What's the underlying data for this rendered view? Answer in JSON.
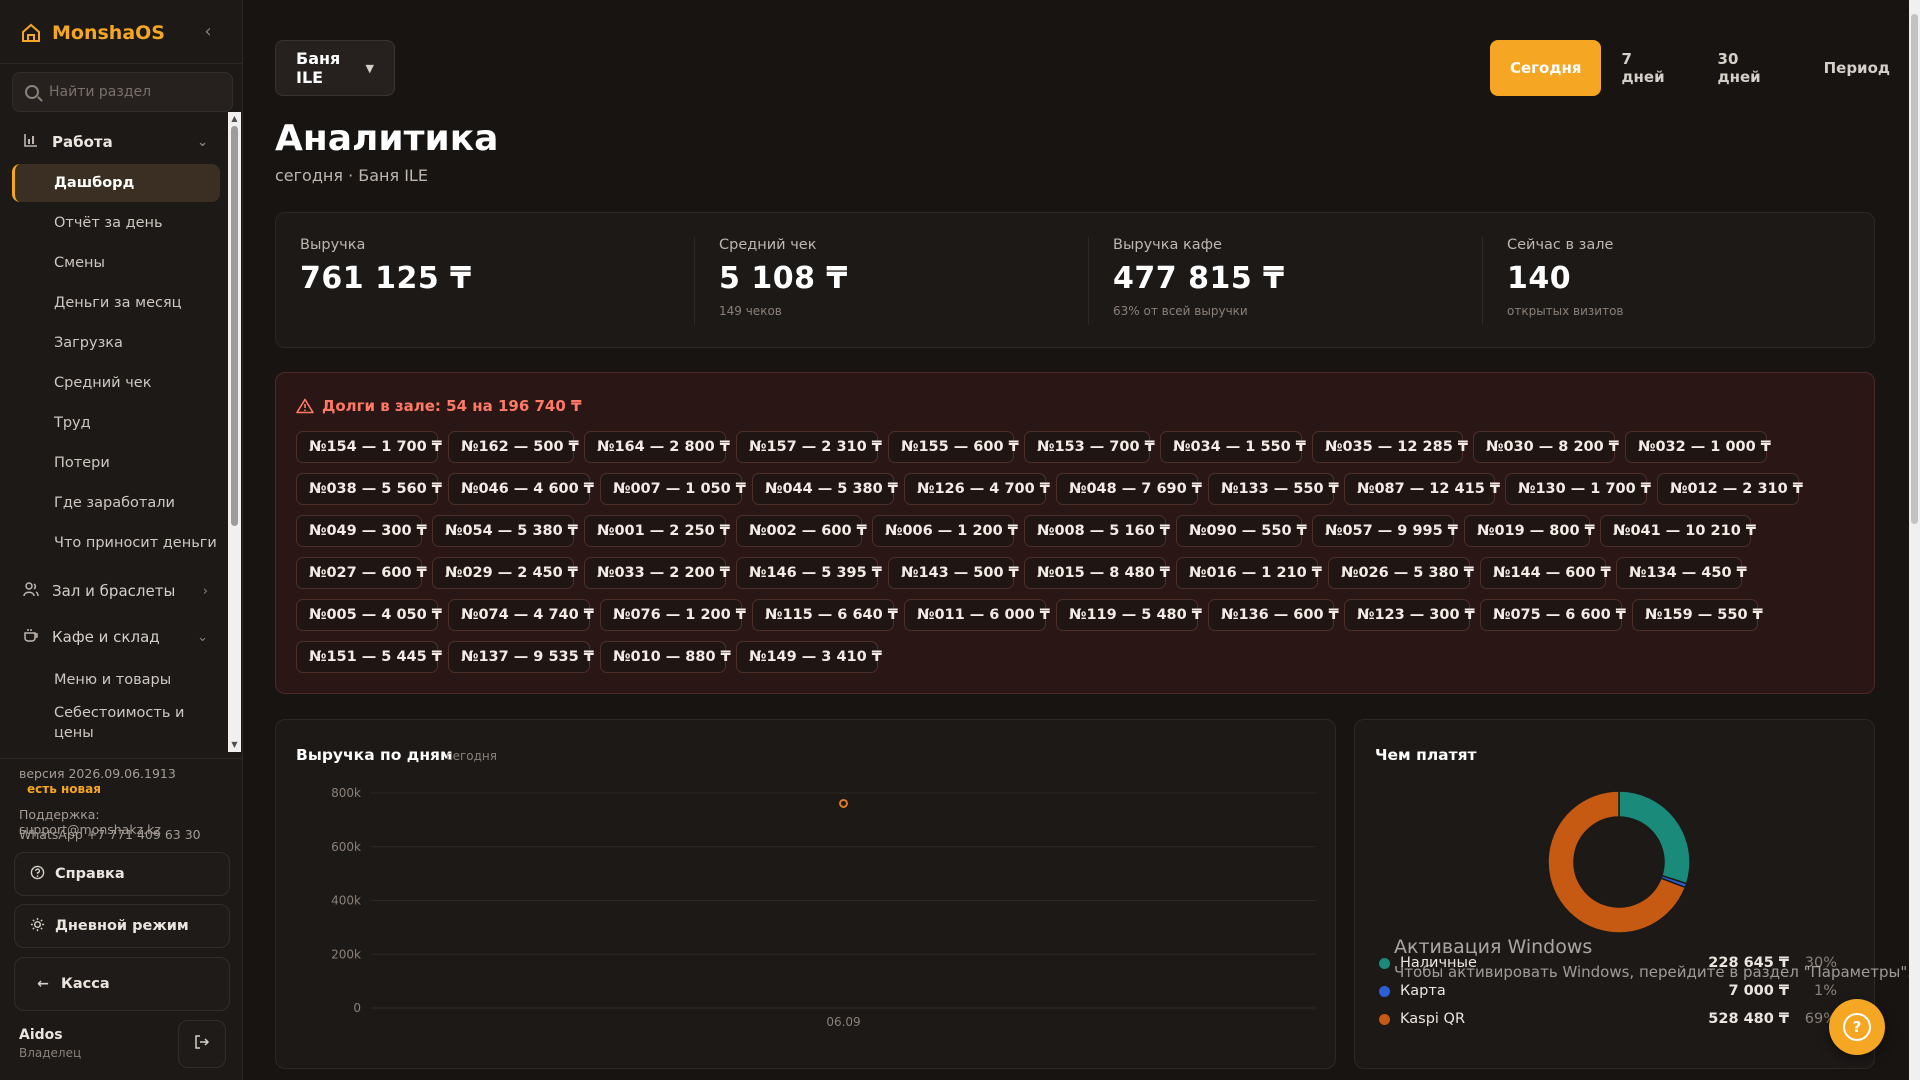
{
  "app": {
    "name": "MonshaOS"
  },
  "sidebar": {
    "search_placeholder": "Найти раздел",
    "groups": {
      "work": "Работа",
      "hall": "Зал и браслеты",
      "cafe": "Кафе и склад"
    },
    "work_items": [
      "Дашборд",
      "Отчёт за день",
      "Смены",
      "Деньги за месяц",
      "Загрузка",
      "Средний чек",
      "Труд",
      "Потери",
      "Где заработали",
      "Что приносит деньги"
    ],
    "cafe_items": [
      "Меню и товары",
      "Себестоимость и цены"
    ],
    "version": "версия 2026.09.06.1913",
    "new_badge": "есть новая",
    "support": "Поддержка: support@monshakz.kz",
    "whatsapp": "WhatsApp +7 771 409 63 30",
    "help_label": "Справка",
    "theme_label": "Дневной режим",
    "kassa_label": "Касса",
    "user": {
      "name": "Aidos",
      "role": "Владелец"
    }
  },
  "header": {
    "venue": "Баня ILE",
    "title": "Аналитика",
    "subtitle": "сегодня · Баня ILE",
    "periods": [
      "Сегодня",
      "7 дней",
      "30 дней",
      "Период"
    ],
    "active_period": "Сегодня"
  },
  "kpis": [
    {
      "label": "Выручка",
      "value": "761 125 ₸",
      "sub": ""
    },
    {
      "label": "Средний чек",
      "value": "5 108 ₸",
      "sub": "149 чеков"
    },
    {
      "label": "Выручка кафе",
      "value": "477 815 ₸",
      "sub": "63% от всей выручки"
    },
    {
      "label": "Сейчас в зале",
      "value": "140",
      "sub": "открытых визитов"
    }
  ],
  "debts": {
    "title": "Долги в зале: 54 на 196 740 ₸",
    "rows": [
      [
        "№154 — 1 700 ₸",
        "№162 — 500 ₸",
        "№164 — 2 800 ₸",
        "№157 — 2 310 ₸",
        "№155 — 600 ₸",
        "№153 — 700 ₸",
        "№034 — 1 550 ₸",
        "№035 — 12 285 ₸",
        "№030 — 8 200 ₸",
        "№032 — 1 000 ₸"
      ],
      [
        "№038 — 5 560 ₸",
        "№046 — 4 600 ₸",
        "№007 — 1 050 ₸",
        "№044 — 5 380 ₸",
        "№126 — 4 700 ₸",
        "№048 — 7 690 ₸",
        "№133 — 550 ₸",
        "№087 — 12 415 ₸",
        "№130 — 1 700 ₸",
        "№012 — 2 310 ₸"
      ],
      [
        "№049 — 300 ₸",
        "№054 — 5 380 ₸",
        "№001 — 2 250 ₸",
        "№002 — 600 ₸",
        "№006 — 1 200 ₸",
        "№008 — 5 160 ₸",
        "№090 — 550 ₸",
        "№057 — 9 995 ₸",
        "№019 — 800 ₸",
        "№041 — 10 210 ₸"
      ],
      [
        "№027 — 600 ₸",
        "№029 — 2 450 ₸",
        "№033 — 2 200 ₸",
        "№146 — 5 395 ₸",
        "№143 — 500 ₸",
        "№015 — 8 480 ₸",
        "№016 — 1 210 ₸",
        "№026 — 5 380 ₸",
        "№144 — 600 ₸",
        "№134 — 450 ₸"
      ],
      [
        "№005 — 4 050 ₸",
        "№074 — 4 740 ₸",
        "№076 — 1 200 ₸",
        "№115 — 6 640 ₸",
        "№011 — 6 000 ₸",
        "№119 — 5 480 ₸",
        "№136 — 600 ₸",
        "№123 — 300 ₸",
        "№075 — 6 600 ₸",
        "№159 — 550 ₸"
      ],
      [
        "№151 — 5 445 ₸",
        "№137 — 9 535 ₸",
        "№010 — 880 ₸",
        "№149 — 3 410 ₸"
      ]
    ]
  },
  "revenue_chart": {
    "title": "Выручка по дням",
    "subtitle": "сегодня"
  },
  "chart_data": {
    "type": "line",
    "x": [
      "06.09"
    ],
    "series": [
      {
        "values": [
          761125
        ]
      }
    ],
    "ylim": [
      0,
      800000
    ],
    "yticks": [
      "0",
      "200k",
      "400k",
      "600k",
      "800k"
    ],
    "grid": true,
    "colors": [
      "#e07a1f"
    ]
  },
  "payments": {
    "title": "Чем платят",
    "items": [
      {
        "label": "Наличные",
        "amount": "228 645 ₸",
        "pct": "30%",
        "value": 228645,
        "color": "#1a8a7a"
      },
      {
        "label": "Карта",
        "amount": "7 000 ₸",
        "pct": "1%",
        "value": 7000,
        "color": "#2c5fd6"
      },
      {
        "label": "Kaspi QR",
        "amount": "528 480 ₸",
        "pct": "69%",
        "value": 528480,
        "color": "#c65a12"
      }
    ]
  },
  "watermark": {
    "title": "Активация Windows",
    "text": "Чтобы активировать Windows, перейдите в раздел \"Параметры\"."
  }
}
